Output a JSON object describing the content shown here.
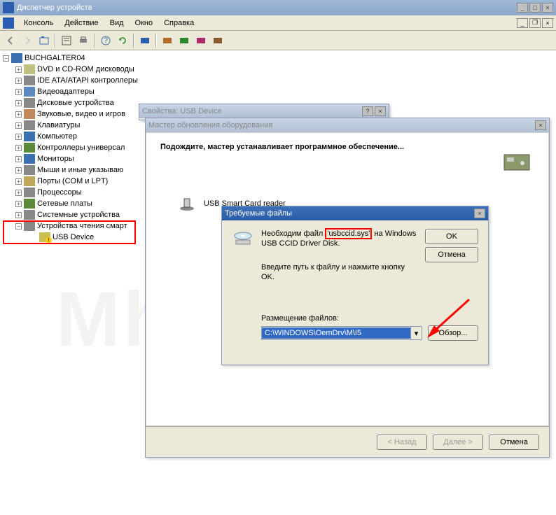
{
  "main_window": {
    "title": "Диспетчер устройств",
    "menu": [
      "Консоль",
      "Действие",
      "Вид",
      "Окно",
      "Справка"
    ]
  },
  "tree": {
    "root": "BUCHGALTER04",
    "items": [
      "DVD и CD-ROM дисководы",
      "IDE ATA/ATAPI контроллеры",
      "Видеоадаптеры",
      "Дисковые устройства",
      "Звуковые, видео и игров",
      "Клавиатуры",
      "Компьютер",
      "Контроллеры универсал",
      "Мониторы",
      "Мыши и иные указываю",
      "Порты (COM и LPT)",
      "Процессоры",
      "Сетевые платы",
      "Системные устройства",
      "Устройства чтения смарт"
    ],
    "child": "USB Device"
  },
  "dlg_props": {
    "title": "Свойства: USB Device"
  },
  "wizard": {
    "title": "Мастер обновления оборудования",
    "heading": "Подождите, мастер устанавливает программное обеспечение...",
    "device": "USB Smart Card reader",
    "back": "< Назад",
    "next": "Далее >",
    "cancel": "Отмена"
  },
  "req": {
    "title": "Требуемые файлы",
    "line1a": "Необходим файл ",
    "file": "'usbccid.sys'",
    "line1b": " на Windows USB CCID Driver Disk.",
    "line2": "Введите путь к файлу и нажмите кнопку OK.",
    "location_label": "Размещение файлов:",
    "path": "C:\\WINDOWS\\OemDrv\\M\\I5",
    "ok": "OK",
    "cancel": "Отмена",
    "browse": "Обзор..."
  },
  "watermark": "Mhelp.kz"
}
